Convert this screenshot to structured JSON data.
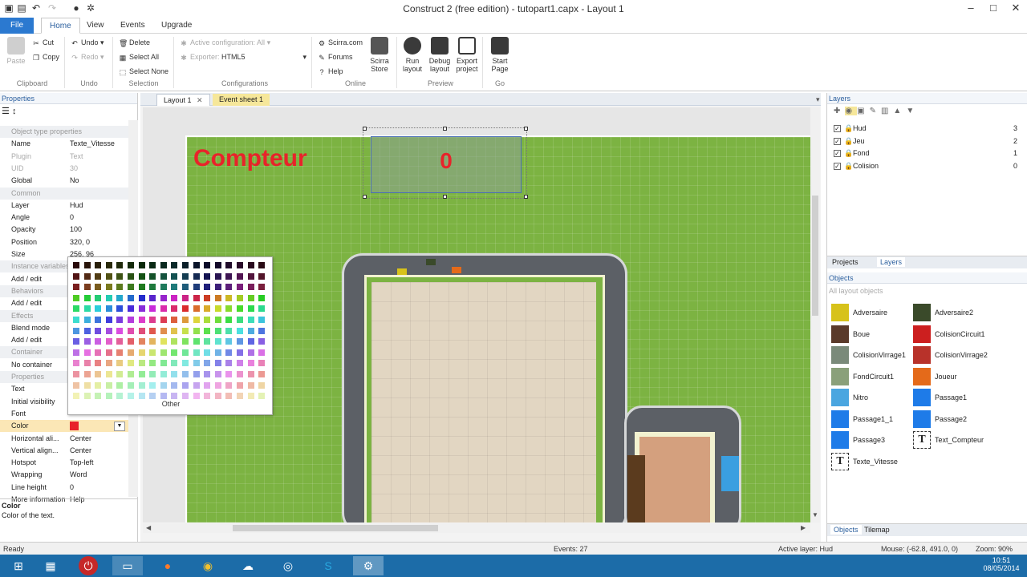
{
  "window": {
    "title": "Construct 2  (free edition) - tutopart1.capx - Layout 1"
  },
  "ribbon_tabs": [
    "File",
    "Home",
    "View",
    "Events",
    "Upgrade"
  ],
  "ribbon": {
    "clipboard": {
      "paste": "Paste",
      "cut": "Cut",
      "copy": "Copy",
      "group": "Clipboard"
    },
    "undo": {
      "undo": "Undo",
      "redo": "Redo",
      "group": "Undo"
    },
    "selection": {
      "delete": "Delete",
      "select_all": "Select All",
      "select_none": "Select None",
      "group": "Selection"
    },
    "configurations": {
      "active": "Active configuration: All",
      "exporter_label": "Exporter:",
      "exporter": "HTML5",
      "group": "Configurations"
    },
    "online": {
      "scirra": "Scirra.com",
      "forums": "Forums",
      "help": "Help",
      "store": "Scirra Store",
      "group": "Online"
    },
    "preview": {
      "run": "Run layout",
      "debug": "Debug layout",
      "export": "Export project",
      "group": "Preview"
    },
    "go": {
      "start": "Start Page",
      "group": "Go"
    }
  },
  "properties": {
    "title": "Properties",
    "rows": [
      {
        "k": "Object type properties",
        "v": "",
        "t": "cat"
      },
      {
        "k": "Name",
        "v": "Texte_Vitesse",
        "t": ""
      },
      {
        "k": "Plugin",
        "v": "Text",
        "t": "dis"
      },
      {
        "k": "UID",
        "v": "30",
        "t": "dis"
      },
      {
        "k": "Global",
        "v": "No",
        "t": ""
      },
      {
        "k": "Common",
        "v": "",
        "t": "cat"
      },
      {
        "k": "Layer",
        "v": "Hud",
        "t": ""
      },
      {
        "k": "Angle",
        "v": "0",
        "t": ""
      },
      {
        "k": "Opacity",
        "v": "100",
        "t": ""
      },
      {
        "k": "Position",
        "v": "320, 0",
        "t": ""
      },
      {
        "k": "Size",
        "v": "256, 96",
        "t": ""
      },
      {
        "k": "Instance variables",
        "v": "",
        "t": "cat"
      },
      {
        "k": "Add / edit",
        "v": "",
        "t": ""
      },
      {
        "k": "Behaviors",
        "v": "",
        "t": "cat"
      },
      {
        "k": "Add / edit",
        "v": "",
        "t": ""
      },
      {
        "k": "Effects",
        "v": "",
        "t": "cat"
      },
      {
        "k": "Blend mode",
        "v": "",
        "t": ""
      },
      {
        "k": "Add / edit",
        "v": "",
        "t": ""
      },
      {
        "k": "Container",
        "v": "",
        "t": "cat"
      },
      {
        "k": "No container",
        "v": "",
        "t": ""
      },
      {
        "k": "Properties",
        "v": "",
        "t": "cat"
      },
      {
        "k": "Text",
        "v": "",
        "t": ""
      },
      {
        "k": "Initial visibility",
        "v": "",
        "t": ""
      },
      {
        "k": "Font",
        "v": "",
        "t": ""
      },
      {
        "k": "Color",
        "v": "",
        "t": "sel"
      },
      {
        "k": "Horizontal ali...",
        "v": "Center",
        "t": ""
      },
      {
        "k": "Vertical align...",
        "v": "Center",
        "t": ""
      },
      {
        "k": "Hotspot",
        "v": "Top-left",
        "t": ""
      },
      {
        "k": "Wrapping",
        "v": "Word",
        "t": ""
      },
      {
        "k": "Line height",
        "v": "0",
        "t": ""
      },
      {
        "k": "More information",
        "v": "Help",
        "t": ""
      }
    ],
    "color_value": "#e8232a",
    "desc_title": "Color",
    "desc_text": "Color of the text."
  },
  "palette": {
    "other": "Other"
  },
  "doc_tabs": [
    "Layout 1",
    "Event sheet 1"
  ],
  "canvas": {
    "label": "Compteur",
    "counter": "0"
  },
  "layers": {
    "title": "Layers",
    "items": [
      {
        "name": "Hud",
        "num": "3"
      },
      {
        "name": "Jeu",
        "num": "2"
      },
      {
        "name": "Fond",
        "num": "1"
      },
      {
        "name": "Colision",
        "num": "0"
      }
    ]
  },
  "panel_tabs": [
    "Projects",
    "Layers"
  ],
  "objects": {
    "title": "Objects",
    "filter": "All layout objects",
    "items": [
      {
        "name": "Adversaire",
        "color": "#d7c21a"
      },
      {
        "name": "Adversaire2",
        "color": "#3a4a2a"
      },
      {
        "name": "Boue",
        "color": "#5a3a2a"
      },
      {
        "name": "ColisionCircuit1",
        "color": "#cc1f1f"
      },
      {
        "name": "ColisionVirrage1",
        "color": "#7a8a7a"
      },
      {
        "name": "ColisionVirrage2",
        "color": "#b8322a"
      },
      {
        "name": "FondCircuit1",
        "color": "#8aa07a"
      },
      {
        "name": "Joueur",
        "color": "#e46a1a"
      },
      {
        "name": "Nitro",
        "color": "#4aa6e0"
      },
      {
        "name": "Passage1",
        "color": "#1e7be8"
      },
      {
        "name": "Passage1_1",
        "color": "#1e7be8"
      },
      {
        "name": "Passage2",
        "color": "#1e7be8"
      },
      {
        "name": "Passage3",
        "color": "#1e7be8"
      },
      {
        "name": "Text_Compteur",
        "color": "text"
      },
      {
        "name": "Texte_Vitesse",
        "color": "text"
      }
    ],
    "bottom_tabs": [
      "Objects",
      "Tilemap"
    ]
  },
  "status": {
    "ready": "Ready",
    "events": "Events: 27",
    "layer": "Active layer: Hud",
    "mouse": "Mouse: (-62.8, 491.0, 0)",
    "zoom": "Zoom: 90%"
  },
  "taskbar": {
    "time": "10:51",
    "date": "08/05/2014"
  }
}
